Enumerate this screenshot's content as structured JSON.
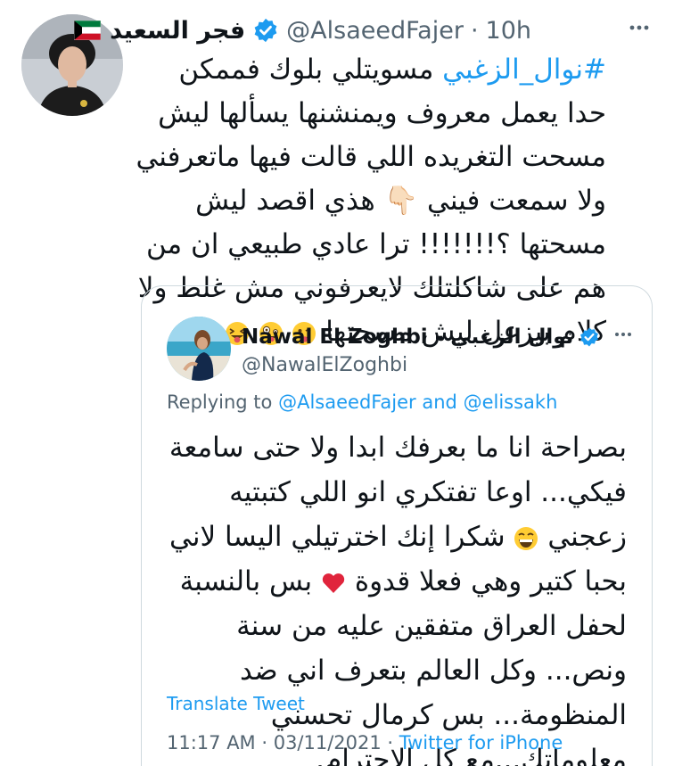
{
  "tweet": {
    "author_name": "فجر السعيد",
    "handle": "@AlsaeedFajer",
    "separator": "·",
    "time": "10h",
    "hashtag": "#نوال_الزغبي",
    "body": "مسويتلي بلوك فممكن حدا يعمل معروف ويمنشنها يسألها ليش مسحت التغريده اللي قالت فيها ماتعرفني ولا سمعت فيني 👇🏻 هذي اقصد ليش مسحتها ؟!!!!!!! ترا عادي طبيعي ان من هم على شاكلتلك لايعرفوني مش غلط ولا كلام بيزعل ليش مسحتها",
    "emojis": [
      "winking-tongue-emoji",
      "zany-face-emoji",
      "squinting-tongue-emoji"
    ]
  },
  "quoted": {
    "author_name": "Nawal El Zoghbi - نوال الزغبي",
    "handle": "@NawalElZoghbi",
    "replying_prefix": "Replying to",
    "replying_mention_1": "@AlsaeedFajer",
    "replying_and": "and",
    "replying_mention_2": "@elissakh",
    "body_1": "بصراحة انا ما بعرفك ابدا ولا حتى سامعة فيكي... اوعا تفتكري انو اللي كتبتيه زعجني",
    "body_2": "شكرا إنك اخترتيلي اليسا لاني بحبا كتير وهي فعلا قدوة",
    "body_3": "بس بالنسبة لحفل العراق متفقين عليه من سنة ونص... وكل العالم بتعرف اني ضد المنظومة... بس كرمال تحسني معلوماتك...مع كل الاحترام.",
    "translate_label": "Translate Tweet",
    "timestamp": "11:17 AM · 03/11/2021 ·",
    "source": "Twitter for iPhone"
  },
  "colors": {
    "link": "#1d9bf0",
    "secondary_text": "#536471",
    "border": "#cfd9de",
    "verified": "#1d9bf0"
  }
}
